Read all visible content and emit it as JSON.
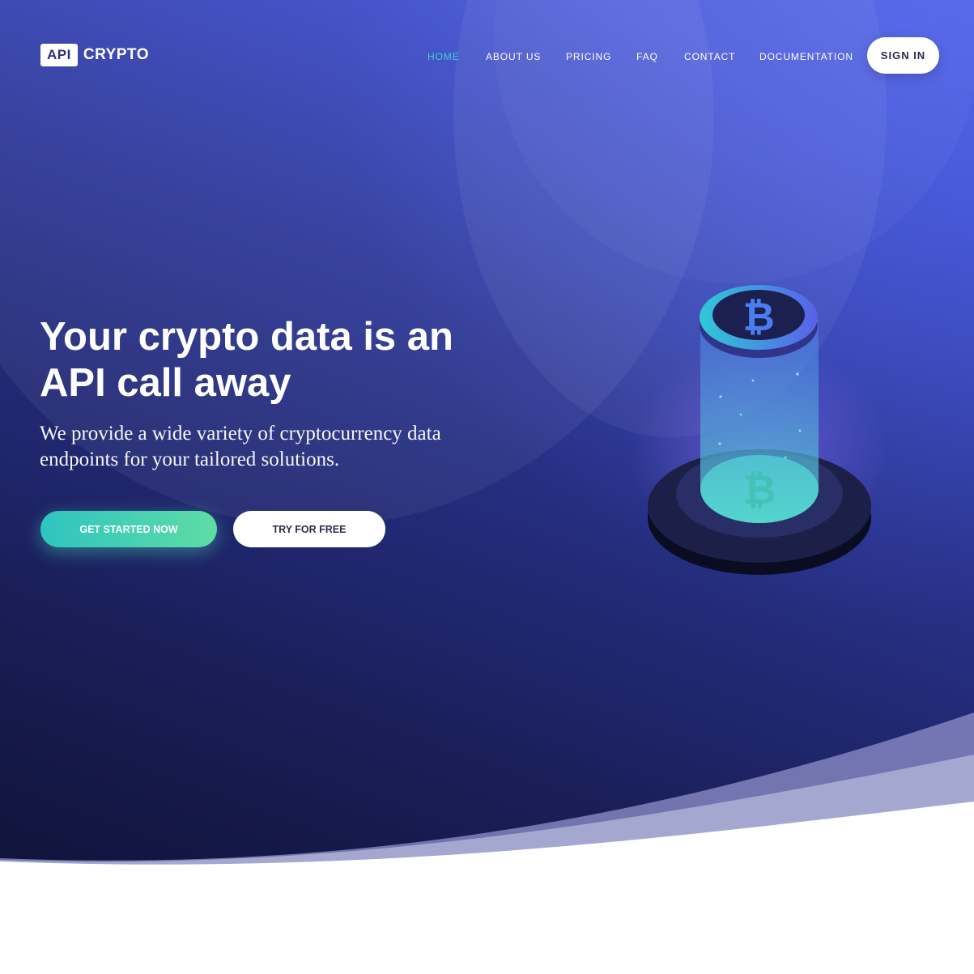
{
  "brand": {
    "logo_badge": "API",
    "logo_text": "CRYPTO"
  },
  "nav": {
    "items": [
      {
        "label": "HOME",
        "active": true
      },
      {
        "label": "ABOUT US",
        "active": false
      },
      {
        "label": "PRICING",
        "active": false
      },
      {
        "label": "FAQ",
        "active": false
      },
      {
        "label": "CONTACT",
        "active": false
      },
      {
        "label": "DOCUMENTATION",
        "active": false
      }
    ],
    "signin_label": "SIGN IN"
  },
  "hero": {
    "headline_line1": "Your crypto data is an",
    "headline_line2": "API call away",
    "subline_line1": "We provide a wide variety of cryptocurrency data",
    "subline_line2": "endpoints for your tailored solutions.",
    "primary_button": "GET STARTED NOW",
    "secondary_button": "TRY FOR FREE",
    "illustration_icon": "bitcoin-icon"
  },
  "colors": {
    "accent": "#3ed0d2",
    "gradient_start": "#0d0f2e",
    "gradient_end": "#4a5de2",
    "button_gradient_start": "#2ec4c0",
    "button_gradient_end": "#5fdca5"
  }
}
